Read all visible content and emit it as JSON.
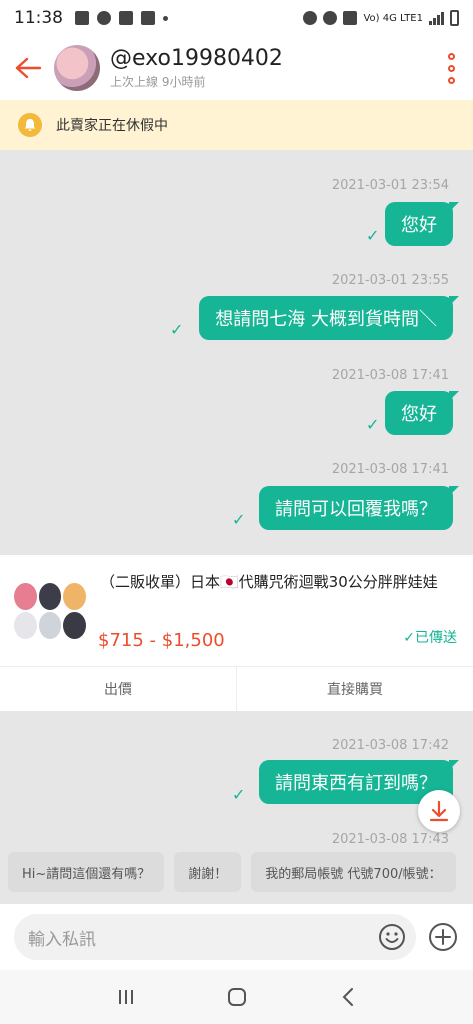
{
  "status_bar": {
    "time": "11:38",
    "network": "Vo) 4G LTE1"
  },
  "header": {
    "username": "@exo19980402",
    "last_online": "上次上線 9小時前"
  },
  "vacation_banner": {
    "text": "此賣家正在休假中"
  },
  "messages": [
    {
      "timestamp": "2021-03-01 23:54",
      "text": "您好"
    },
    {
      "timestamp": "2021-03-01 23:55",
      "text": "想請問七海 大概到貨時間＼"
    },
    {
      "timestamp": "2021-03-08 17:41",
      "text": "您好"
    },
    {
      "timestamp": "2021-03-08 17:41",
      "text": "請問可以回覆我嗎？"
    },
    {
      "timestamp": "2021-03-08 17:42",
      "text": "請問東西有訂到嗎？"
    },
    {
      "timestamp": "2021-03-08 17:43",
      "text": ""
    }
  ],
  "product": {
    "title": "（二販收單）日本🇯🇵代購咒術迴戰30公分胖胖娃娃",
    "price": "$715 - $1,500",
    "sent_label": "✓已傳送",
    "offer_label": "出價",
    "buy_label": "直接購買"
  },
  "quick_replies": [
    "Hi~請問這個還有嗎？",
    "謝謝！",
    "我的郵局帳號 代號700/帳號："
  ],
  "composer": {
    "placeholder": "輸入私訊"
  },
  "colors": {
    "accent": "#ee4d2d",
    "bubble": "#16b595",
    "banner": "#fff3d4"
  }
}
